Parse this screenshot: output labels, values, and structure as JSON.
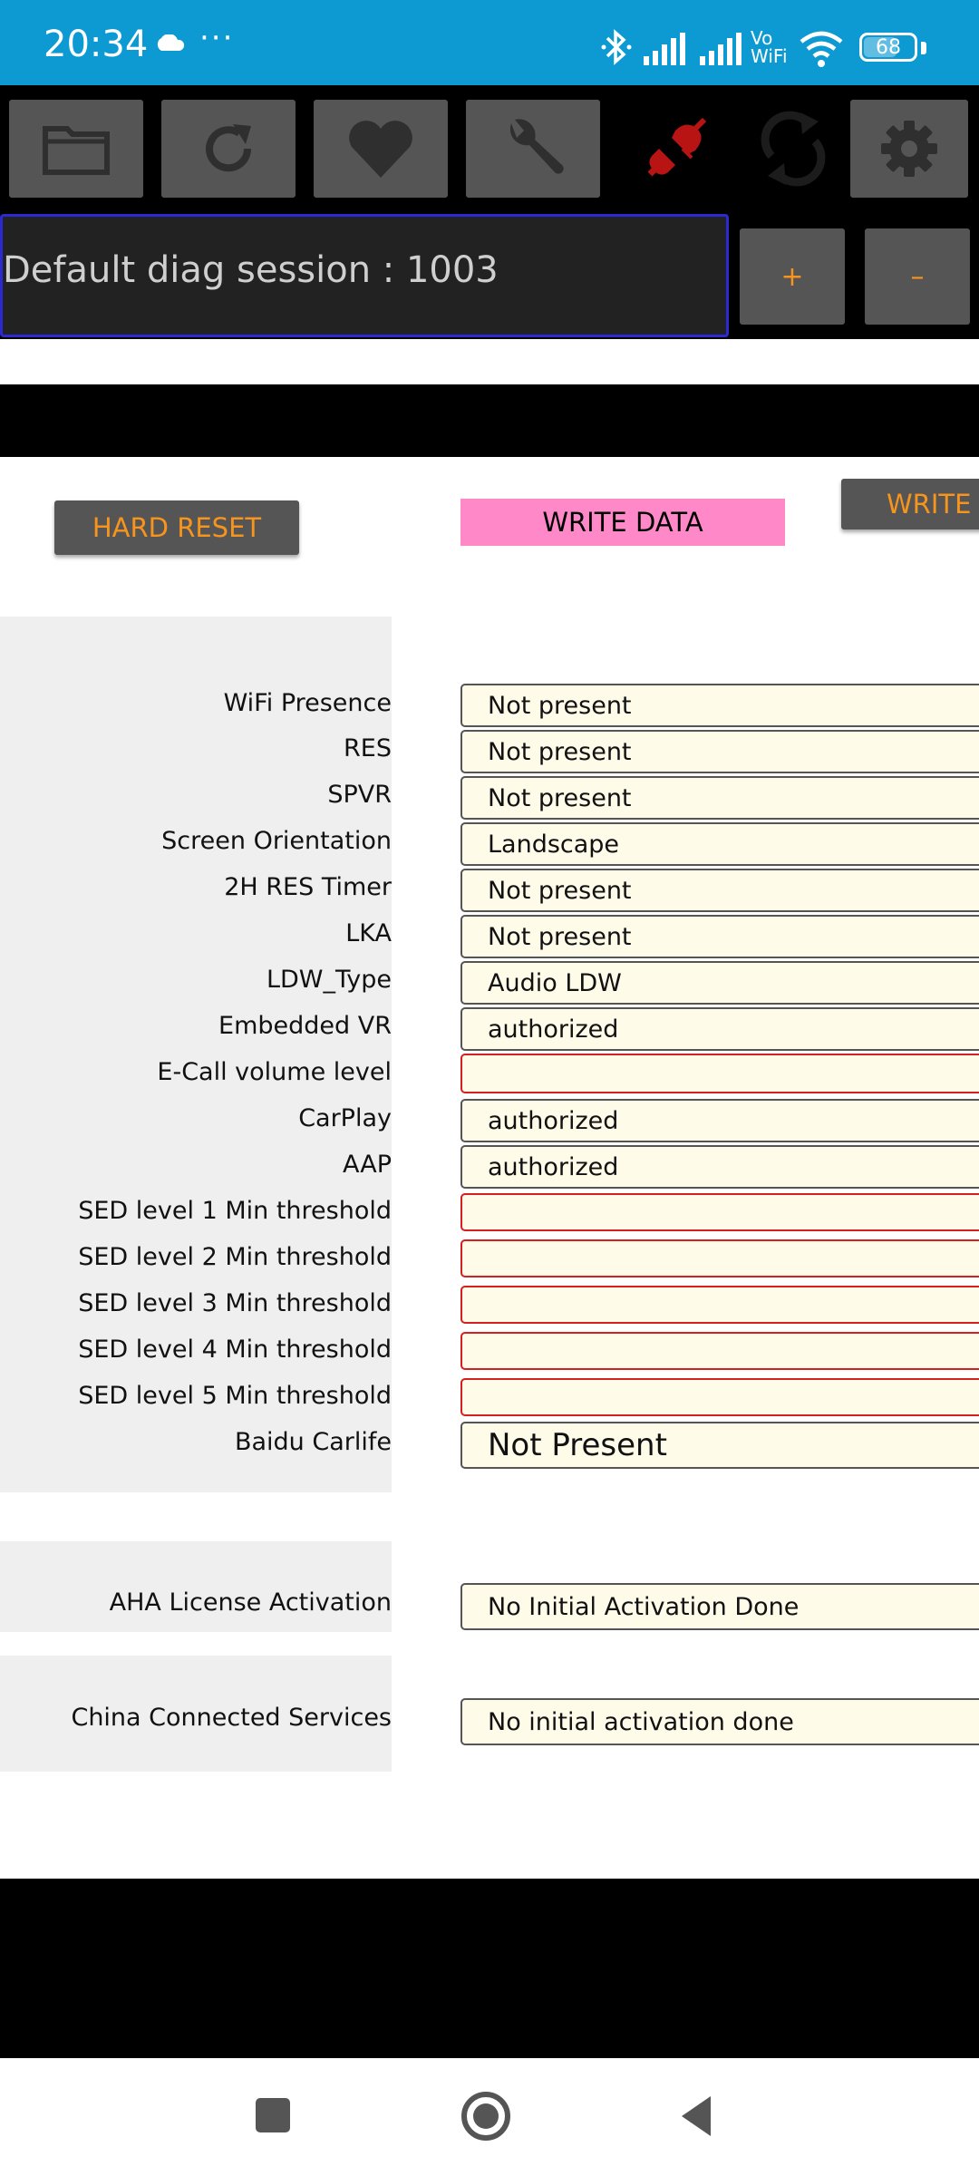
{
  "status_bar": {
    "time": "20:34",
    "dots": "···",
    "network_label": "Vo WiFi",
    "battery": "68"
  },
  "toolbar": {
    "icons": [
      "folder-icon",
      "refresh-icon",
      "heart-icon",
      "wrench-icon",
      "disconnected-plug-icon",
      "sync-icon",
      "gear-icon"
    ],
    "session_text": "Default diag session : 1003",
    "plus_label": "+",
    "minus_label": "–"
  },
  "actions": {
    "hard_reset": "HARD RESET",
    "write_data": "WRITE DATA",
    "write_partial": "WRITE"
  },
  "parameters": [
    {
      "label": "WiFi Presence",
      "value": "Not present"
    },
    {
      "label": "RES",
      "value": "Not present"
    },
    {
      "label": "SPVR",
      "value": "Not present"
    },
    {
      "label": "Screen Orientation",
      "value": "Landscape"
    },
    {
      "label": "2H RES Timer",
      "value": "Not present"
    },
    {
      "label": "LKA",
      "value": "Not present"
    },
    {
      "label": "LDW_Type",
      "value": "Audio LDW"
    },
    {
      "label": "Embedded VR",
      "value": "authorized"
    },
    {
      "label": "E-Call volume level",
      "value": ""
    },
    {
      "label": "CarPlay",
      "value": "authorized"
    },
    {
      "label": "AAP",
      "value": "authorized"
    },
    {
      "label": "SED level 1 Min threshold",
      "value": ""
    },
    {
      "label": "SED level 2 Min threshold",
      "value": ""
    },
    {
      "label": "SED level 3 Min threshold",
      "value": ""
    },
    {
      "label": "SED level 4 Min threshold",
      "value": ""
    },
    {
      "label": "SED level 5 Min threshold",
      "value": ""
    },
    {
      "label": "Baidu Carlife",
      "value": "Not Present"
    }
  ],
  "aha": {
    "label": "AHA License Activation",
    "value": "No Initial Activation Done"
  },
  "china": {
    "label": "China Connected Services",
    "value": "No initial activation done"
  },
  "colors": {
    "status_bar": "#0d9ad3",
    "accent_orange": "#f7941d",
    "write_pink": "#ff88c8",
    "error_red": "#d42020"
  }
}
